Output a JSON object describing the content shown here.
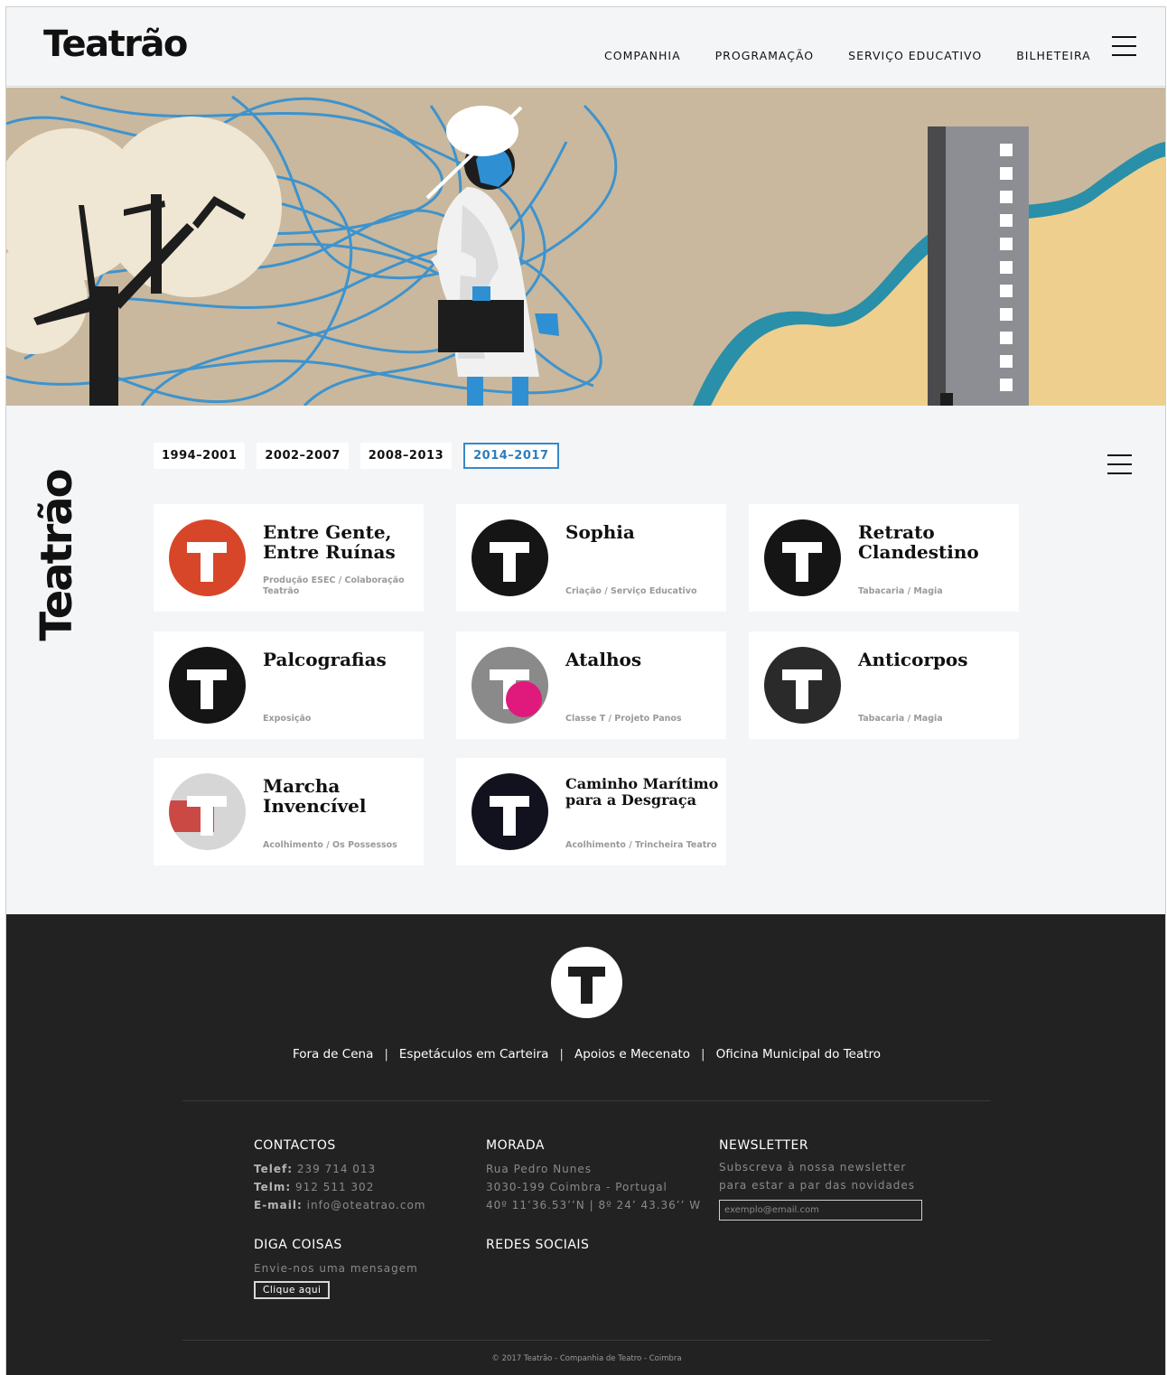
{
  "brand": {
    "name": "Teatrão"
  },
  "nav": {
    "items": [
      "COMPANHIA",
      "PROGRAMAÇÃO",
      "SERVIÇO EDUCATIVO",
      "BILHETEIRA"
    ]
  },
  "colors": {
    "accent": "#3b88c4",
    "footer_bg": "#222222",
    "hero_bg": "#c9b89d",
    "hero_scribble": "#2f8fd3",
    "hero_sand": "#efcf8e",
    "hero_teal": "#2a8fa8"
  },
  "periods": [
    "1994–2001",
    "2002–2007",
    "2008–2013",
    "2014–2017"
  ],
  "active_period": "2014–2017",
  "shows": [
    {
      "title": "Entre Gente, Entre Ruínas",
      "subtitle": "Produção ESEC / Colaboração Teatrão",
      "thumb": "#d8462a"
    },
    {
      "title": "Sophia",
      "subtitle": "Criação / Serviço Educativo",
      "thumb": "#111111"
    },
    {
      "title": "Retrato Clandestino",
      "subtitle": "Tabacaria / Magia",
      "thumb": "#111111"
    },
    {
      "title": "Palcografias",
      "subtitle": "Exposição",
      "thumb": "#1a1a1a"
    },
    {
      "title": "Atalhos",
      "subtitle": "Classe T / Projeto Panos",
      "thumb": "#8a8a8a"
    },
    {
      "title": "Anticorpos",
      "subtitle": "Tabacaria / Magia",
      "thumb": "#2a2a2a"
    },
    {
      "title": "Marcha Invencível",
      "subtitle": "Acolhimento / Os Possessos",
      "thumb": "#d6d6d6"
    },
    {
      "title": "Caminho Marítimo para a Desgraça",
      "subtitle": "Acolhimento / Trincheira Teatro",
      "thumb": "#12121e"
    }
  ],
  "footer": {
    "links": [
      "Fora de Cena",
      "Espetáculos em Carteira",
      "Apoios e Mecenato",
      "Oficina Municipal do Teatro"
    ],
    "separator": "|",
    "contactos": {
      "heading": "CONTACTOS",
      "telef_label": "Telef:",
      "telef": "239 714 013",
      "telm_label": "Telm:",
      "telm": "912 511 302",
      "email_label": "E-mail:",
      "email": "info@oteatrao.com"
    },
    "morada": {
      "heading": "MORADA",
      "line1": "Rua Pedro Nunes",
      "line2": "3030-199 Coimbra - Portugal",
      "line3": "40º 11’36.53’’N | 8º 24’ 43.36’’ W"
    },
    "newsletter": {
      "heading": "NEWSLETTER",
      "line1": "Subscreva à nossa newsletter",
      "line2": "para estar a par das novidades",
      "placeholder": "exemplo@email.com"
    },
    "diga": {
      "heading": "DIGA COISAS",
      "line1": "Envie-nos uma mensagem",
      "button": "Clique aqui"
    },
    "redes": {
      "heading": "REDES SOCIAIS"
    },
    "copyright": "© 2017 Teatrão - Companhia de Teatro - Coimbra"
  }
}
